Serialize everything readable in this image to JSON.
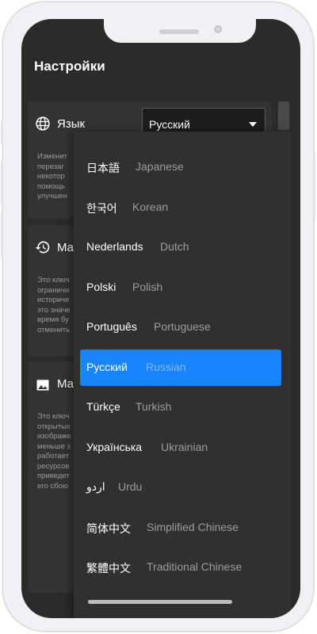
{
  "page": {
    "title": "Настройки"
  },
  "settings": {
    "language": {
      "icon": "globe-icon",
      "label": "Язык",
      "selected": "Русский",
      "description_lines": [
        "Изменит",
        "перезаг",
        "некотор",
        "помощь",
        "улучшен"
      ]
    },
    "history": {
      "icon": "history-icon",
      "label": "Ма",
      "description_lines": [
        "Это ключ",
        "ограничи",
        "историче",
        "это значе",
        "время бу",
        "отменить"
      ]
    },
    "images": {
      "icon": "image-icon",
      "label": "Ма",
      "description_lines": [
        "Это ключ",
        "открытых",
        "изображе",
        "меньше з",
        "работает",
        "ресурсов",
        "приведет",
        "его сбою"
      ]
    }
  },
  "language_options": [
    {
      "native": "日本語",
      "english": "Japanese"
    },
    {
      "native": "한국어",
      "english": "Korean"
    },
    {
      "native": "Nederlands",
      "english": "Dutch"
    },
    {
      "native": "Polski",
      "english": "Polish"
    },
    {
      "native": "Português",
      "english": "Portuguese"
    },
    {
      "native": "Русский",
      "english": "Russian",
      "selected": true
    },
    {
      "native": "Türkçe",
      "english": "Turkish"
    },
    {
      "native": "Українська",
      "english": "Ukrainian"
    },
    {
      "native": "اردو",
      "english": "Urdu"
    },
    {
      "native": "简体中文",
      "english": "Simplified Chinese"
    },
    {
      "native": "繁體中文",
      "english": "Traditional Chinese"
    }
  ],
  "colors": {
    "accent": "#1a84ff",
    "background": "#2b2b2b",
    "card": "#333333",
    "dropdown": "#303030"
  }
}
